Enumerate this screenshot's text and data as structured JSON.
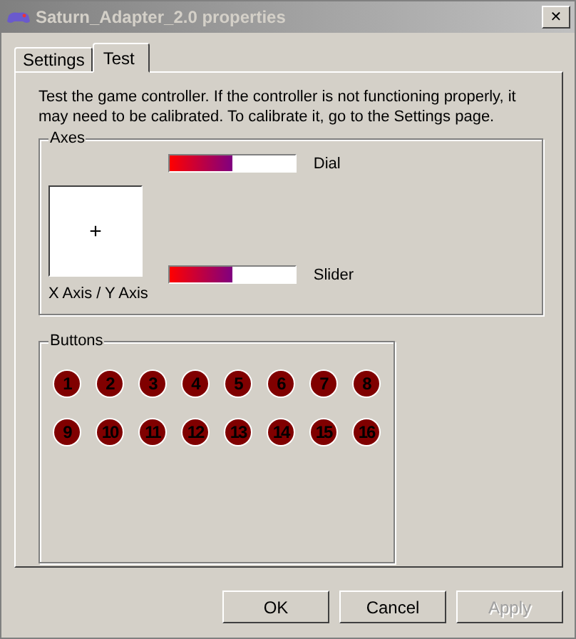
{
  "window": {
    "title": "Saturn_Adapter_2.0 properties",
    "close": "✕"
  },
  "tabs": [
    {
      "label": "Settings",
      "selected": false
    },
    {
      "label": "Test",
      "selected": true
    }
  ],
  "intro": "Test the game controller.  If the controller is not functioning properly, it may need to be calibrated.  To calibrate it, go to the Settings page.",
  "axes": {
    "title": "Axes",
    "xy_label": "X Axis / Y Axis",
    "crosshair": "+",
    "meters": [
      {
        "label": "Dial",
        "level": 0.5
      },
      {
        "label": "Slider",
        "level": 0.5
      }
    ]
  },
  "buttons_group": {
    "title": "Buttons",
    "buttons": [
      {
        "label": "1",
        "pressed": false
      },
      {
        "label": "2",
        "pressed": false
      },
      {
        "label": "3",
        "pressed": false
      },
      {
        "label": "4",
        "pressed": false
      },
      {
        "label": "5",
        "pressed": false
      },
      {
        "label": "6",
        "pressed": false
      },
      {
        "label": "7",
        "pressed": false
      },
      {
        "label": "8",
        "pressed": false
      },
      {
        "label": "9",
        "pressed": false
      },
      {
        "label": "10",
        "pressed": false
      },
      {
        "label": "11",
        "pressed": false
      },
      {
        "label": "12",
        "pressed": false
      },
      {
        "label": "13",
        "pressed": false
      },
      {
        "label": "14",
        "pressed": false
      },
      {
        "label": "15",
        "pressed": false
      },
      {
        "label": "16",
        "pressed": false
      }
    ]
  },
  "dialog_buttons": [
    {
      "label": "OK",
      "disabled": false
    },
    {
      "label": "Cancel",
      "disabled": false
    },
    {
      "label": "Apply",
      "disabled": true
    }
  ]
}
